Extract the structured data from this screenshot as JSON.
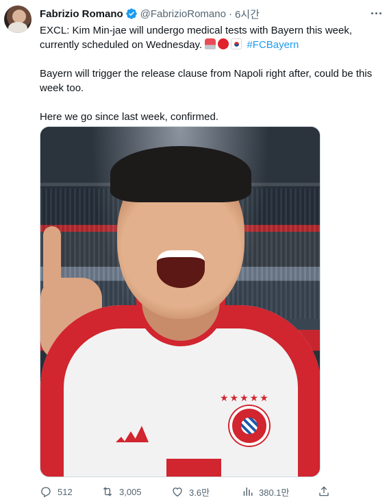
{
  "author": {
    "name": "Fabrizio Romano",
    "handle": "@FabrizioRomano",
    "separator": "·",
    "time": "6시간",
    "verified": true
  },
  "tweet": {
    "line1": "EXCL: Kim Min-jae will undergo medical tests with Bayern this week, currently scheduled on Wednesday.",
    "emojis": [
      "siren-emoji",
      "red-circle-emoji",
      "south-korea-flag-emoji"
    ],
    "hashtag": "#FCBayern",
    "line2": "Bayern will trigger the release clause from Napoli right after, could be this week too.",
    "line3": "Here we go since last week, confirmed."
  },
  "actions": {
    "replies": "512",
    "retweets": "3,005",
    "likes": "3.6만",
    "views": "380.1만"
  },
  "colors": {
    "text": "#0f1419",
    "secondary": "#536471",
    "link": "#1d9bf0",
    "verified": "#1d9bf0",
    "bayern_red": "#d1252f"
  }
}
